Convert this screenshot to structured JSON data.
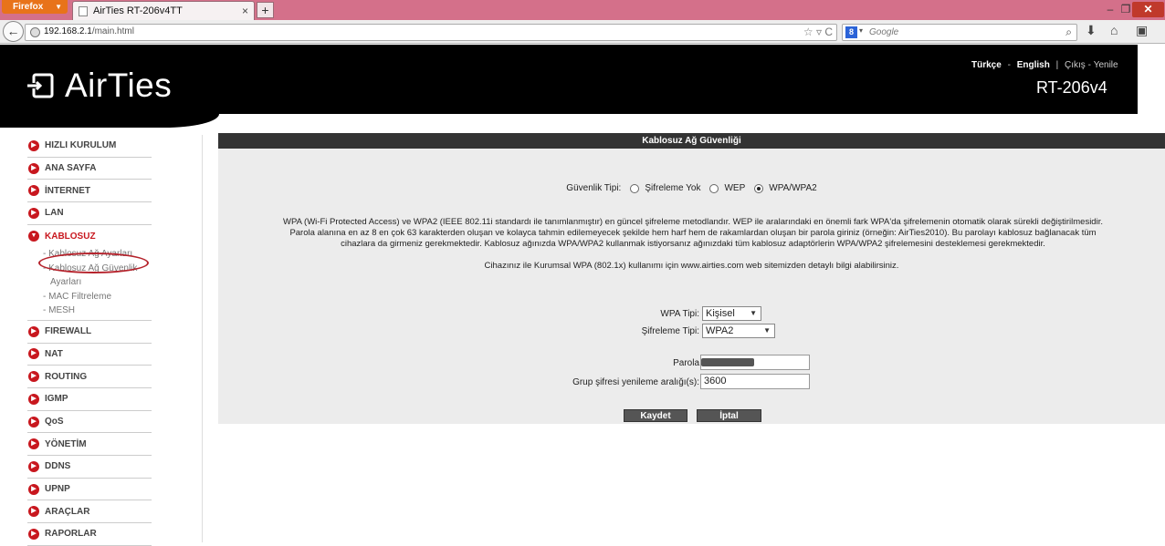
{
  "browser": {
    "app_button": "Firefox",
    "tab_title": "AirTies RT-206v4TT",
    "new_tab": "+",
    "url_host": "192.168.2.1",
    "url_path": "/main.html",
    "search_placeholder": "Google",
    "search_engine_letter": "8"
  },
  "header": {
    "brand": "AirTies",
    "lang_tr": "Türkçe",
    "lang_sep": "-",
    "lang_en": "English",
    "pipe": "|",
    "logout": "Çıkış",
    "refresh": "Yenile",
    "model": "RT-206v4"
  },
  "sidebar": {
    "items_top": [
      "HIZLI KURULUM",
      "ANA SAYFA",
      "İNTERNET",
      "LAN"
    ],
    "active": "KABLOSUZ",
    "sub_items": [
      "Kablosuz Ağ Ayarları",
      "Kablosuz Ağ Güvenlik",
      "Ayarları",
      "MAC Filtreleme",
      "MESH"
    ],
    "items_bottom": [
      "FIREWALL",
      "NAT",
      "ROUTING",
      "IGMP",
      "QoS",
      "YÖNETİM",
      "DDNS",
      "UPNP",
      "ARAÇLAR",
      "RAPORLAR"
    ]
  },
  "panel": {
    "title": "Kablosuz Ağ Güvenliği",
    "security_type_label": "Güvenlik Tipi:",
    "options": [
      "Şifreleme Yok",
      "WEP",
      "WPA/WPA2"
    ],
    "selected_option": "WPA/WPA2",
    "description_line1": "WPA (Wi-Fi Protected Access) ve WPA2 (IEEE 802.11i standardı ile tanımlanmıştır) en güncel şifreleme metodlandır. WEP ile aralarındaki en önemli fark WPA'da şifrelemenin otomatik olarak sürekli değiştirilmesidir.",
    "description_line2": "Parola alanına en az 8 en çok 63 karakterden oluşan ve kolayca tahmin edilemeyecek şekilde hem harf hem de rakamlardan oluşan bir parola giriniz (örneğin: AirTies2010). Bu parolayı kablosuz bağlanacak tüm",
    "description_line3": "cihazlara da girmeniz gerekmektedir. Kablosuz ağınızda WPA/WPA2 kullanmak istiyorsanız ağınızdaki tüm kablosuz adaptörlerin WPA/WPA2 şifrelemesini desteklemesi gerekmektedir.",
    "info": "Cihazınız ile Kurumsal WPA (802.1x) kullanımı için www.airties.com web sitemizden detaylı bilgi alabilirsiniz.",
    "wpa_type_label": "WPA Tipi:",
    "wpa_type_value": "Kişisel",
    "enc_type_label": "Şifreleme Tipi:",
    "enc_type_value": "WPA2",
    "password_label": "Parola",
    "group_key_label": "Grup şifresi yenileme aralığı(s):",
    "group_key_value": "3600",
    "save": "Kaydet",
    "cancel": "İptal"
  },
  "colors": {
    "brand_red": "#c8171e",
    "header_bg": "#000000",
    "panel_title_bg": "#333333",
    "panel_bg": "#ececec",
    "highlight": "#b5222b"
  }
}
